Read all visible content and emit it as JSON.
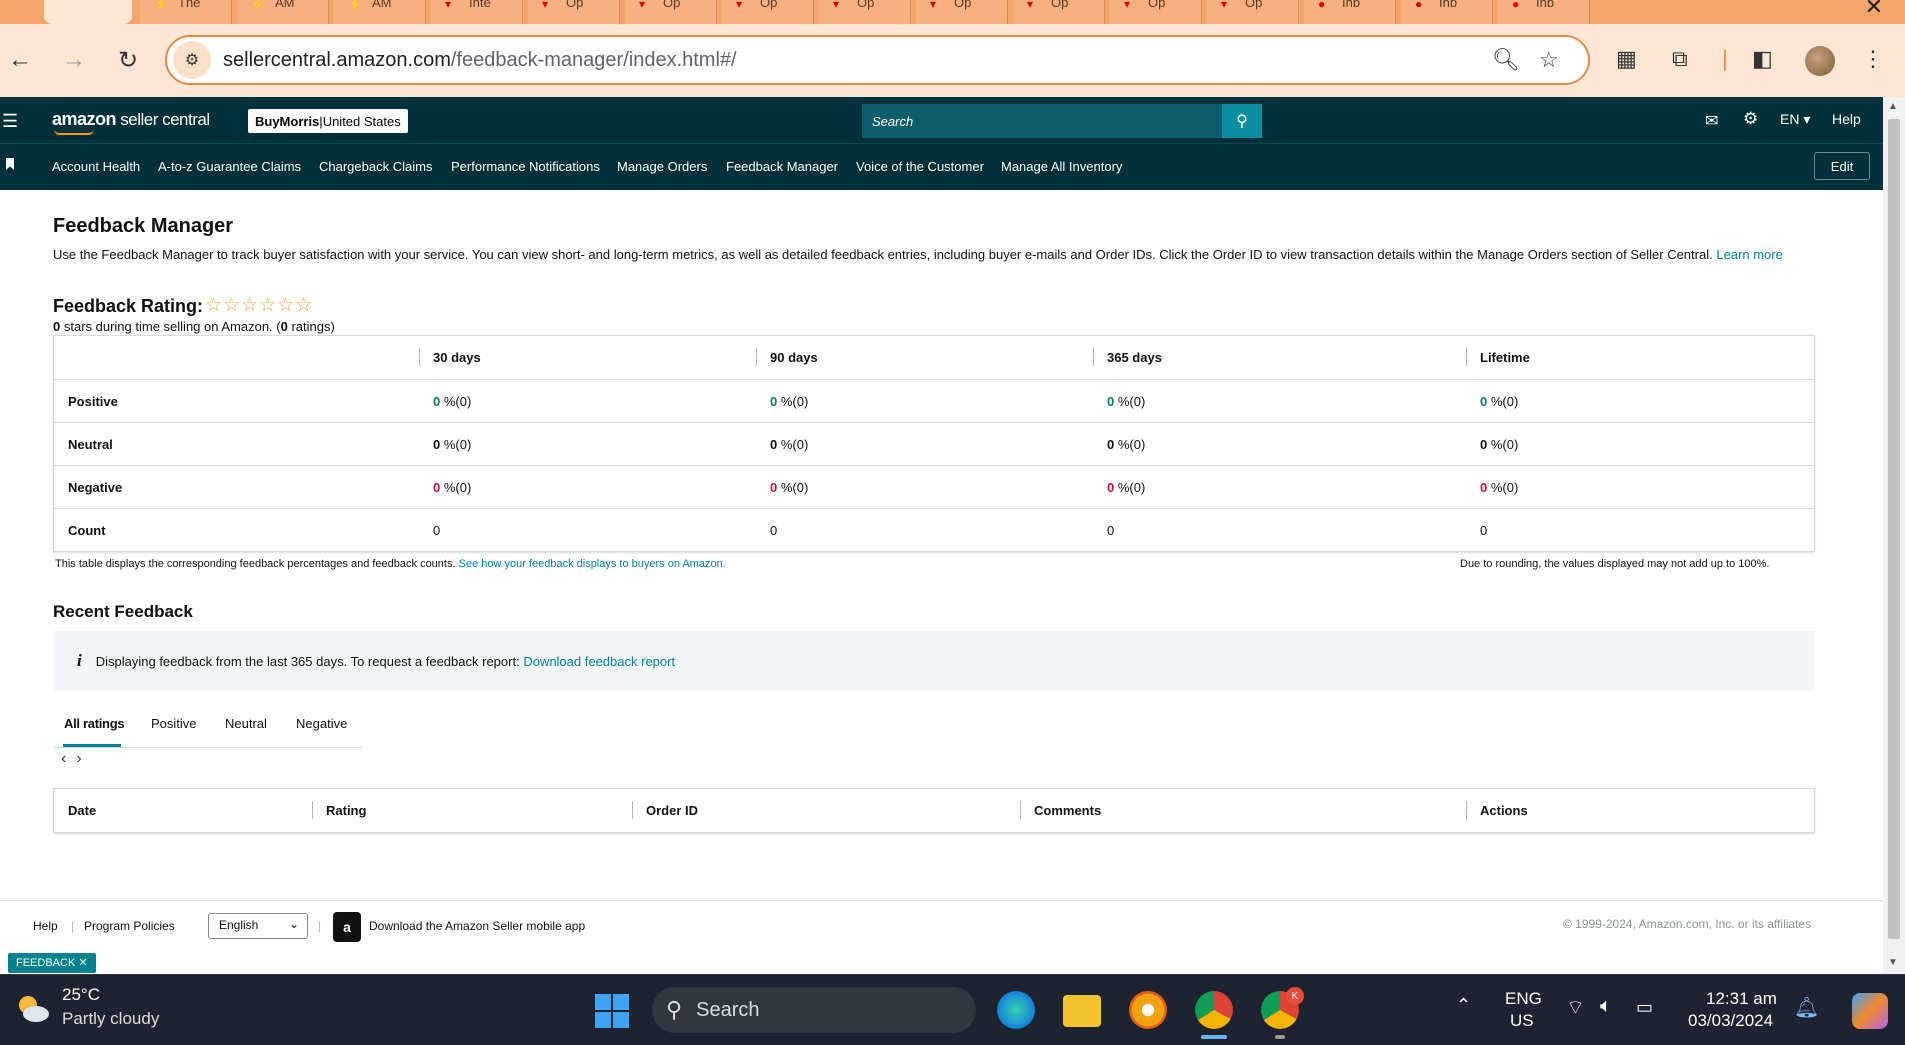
{
  "browser": {
    "tab_partial_titles": [
      "The",
      "AM",
      "AM",
      "Inte",
      "Op",
      "Op",
      "Op",
      "Op",
      "Op",
      "Op",
      "Op",
      "Op",
      "Inb",
      "Inb",
      "Inb"
    ],
    "url_domain": "sellercentral.amazon.com",
    "url_path": "/feedback-manager/index.html#/"
  },
  "header": {
    "logo_text_bold": "amazon",
    "logo_text_rest": " seller central",
    "account_name": "BuyMorris",
    "account_sep": " | ",
    "account_region": "United States",
    "search_placeholder": "Search",
    "language": "EN",
    "help": "Help"
  },
  "nav": {
    "items": [
      "Account Health",
      "A-to-z Guarantee Claims",
      "Chargeback Claims",
      "Performance Notifications",
      "Manage Orders",
      "Feedback Manager",
      "Voice of the Customer",
      "Manage All Inventory"
    ],
    "edit": "Edit"
  },
  "page": {
    "title": "Feedback Manager",
    "description": "Use the Feedback Manager to track buyer satisfaction with your service. You can view short- and long-term metrics, as well as detailed feedback entries, including buyer e-mails and Order IDs. Click the Order ID to view transaction details within the Manage Orders section of Seller Central.",
    "learn_more": "Learn more",
    "rating_title": "Feedback Rating:",
    "stars": "☆☆☆☆☆☆",
    "rating_stars_value": "0",
    "rating_sub_mid": " stars during time selling on Amazon. (",
    "rating_count": "0",
    "rating_sub_end": " ratings)"
  },
  "metrics": {
    "columns": [
      "30 days",
      "90 days",
      "365 days",
      "Lifetime"
    ],
    "rows": [
      {
        "label": "Positive",
        "cells": [
          {
            "num": "0",
            "rest": " %(0)"
          },
          {
            "num": "0",
            "rest": " %(0)"
          },
          {
            "num": "0",
            "rest": " %(0)"
          },
          {
            "num": "0",
            "rest": " %(0)"
          }
        ]
      },
      {
        "label": "Neutral",
        "cells": [
          {
            "num": "0",
            "rest": " %(0)"
          },
          {
            "num": "0",
            "rest": " %(0)"
          },
          {
            "num": "0",
            "rest": " %(0)"
          },
          {
            "num": "0",
            "rest": " %(0)"
          }
        ]
      },
      {
        "label": "Negative",
        "cells": [
          {
            "num": "0",
            "rest": " %(0)"
          },
          {
            "num": "0",
            "rest": " %(0)"
          },
          {
            "num": "0",
            "rest": " %(0)"
          },
          {
            "num": "0",
            "rest": " %(0)"
          }
        ]
      },
      {
        "label": "Count",
        "cells": [
          {
            "num": "",
            "rest": "0"
          },
          {
            "num": "",
            "rest": "0"
          },
          {
            "num": "",
            "rest": "0"
          },
          {
            "num": "",
            "rest": "0"
          }
        ]
      }
    ],
    "note_left": "This table displays the corresponding feedback percentages and feedback counts.",
    "note_link": "See how your feedback displays to buyers on Amazon.",
    "note_right": "Due to rounding, the values displayed may not add up to 100%."
  },
  "recent": {
    "title": "Recent Feedback",
    "info_icon": "i",
    "info_text": "Displaying feedback from the last 365 days. To request a feedback report:",
    "info_link": "Download feedback report",
    "tabs": [
      "All ratings",
      "Positive",
      "Neutral",
      "Negative"
    ],
    "table_headers": [
      "Date",
      "Rating",
      "Order ID",
      "Comments",
      "Actions"
    ]
  },
  "footer": {
    "help": "Help",
    "policies": "Program Policies",
    "language": "English",
    "app_text": "Download the Amazon Seller mobile app",
    "copyright": "© 1999-2024, Amazon.com, Inc. or its affiliates",
    "feedback_badge": "FEEDBACK ✕"
  },
  "taskbar": {
    "temp": "25°C",
    "weather": "Partly cloudy",
    "search": "Search",
    "lang1": "ENG",
    "lang2": "US",
    "time": "12:31 am",
    "date": "03/03/2024",
    "chrome_badge": "K"
  },
  "colors": {
    "amazon_header": "#00303a",
    "accent": "#008296",
    "positive": "#067d62",
    "negative": "#cc0c39"
  }
}
